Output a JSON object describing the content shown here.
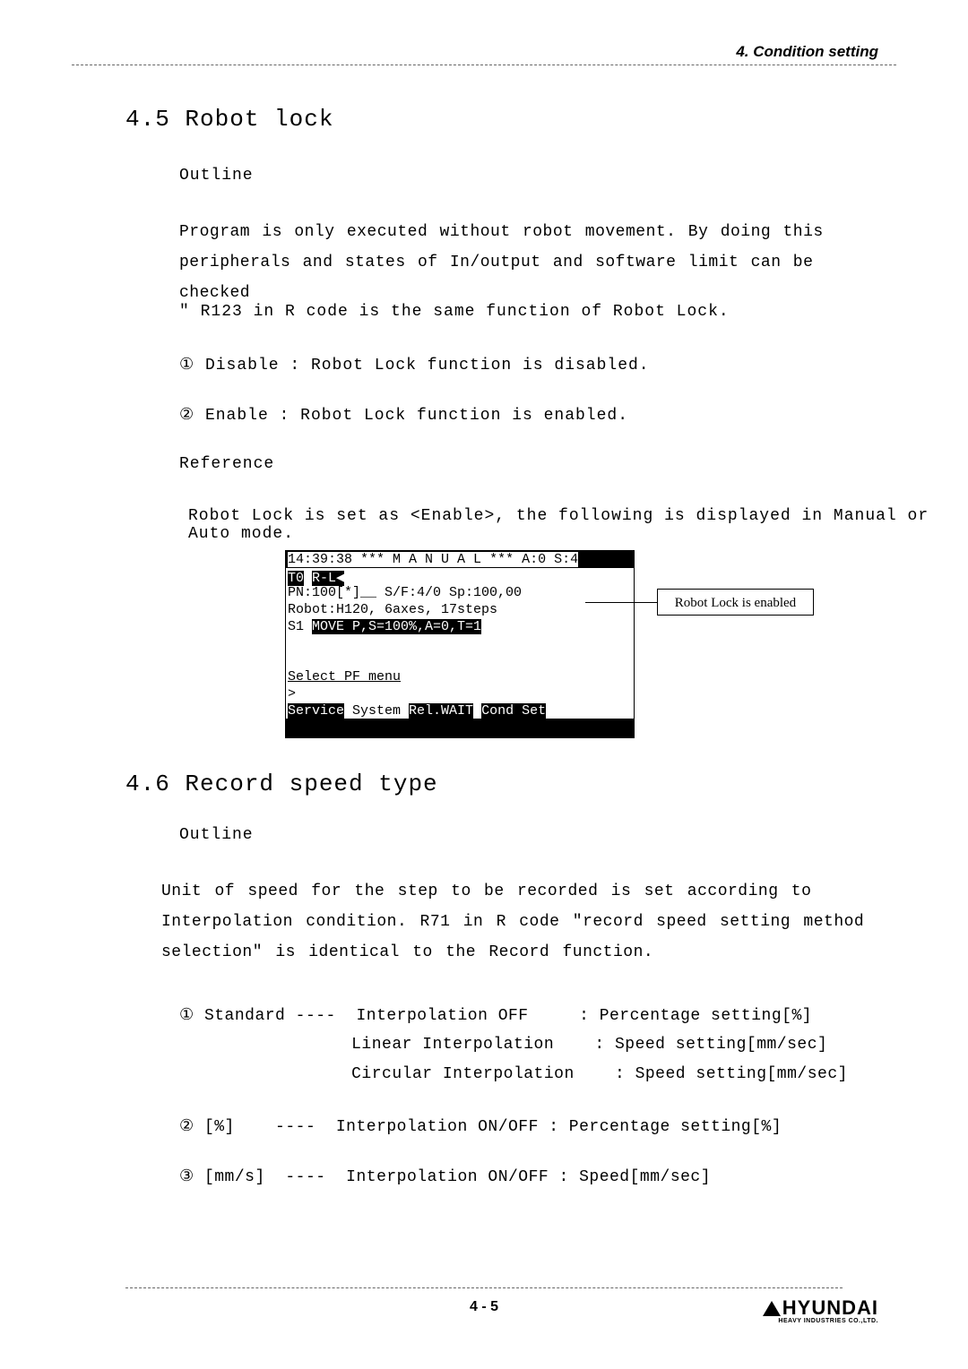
{
  "header": {
    "section_label": "4. Condition setting"
  },
  "section_45": {
    "heading": "4.5 Robot lock",
    "outline_label": "Outline",
    "body1": "Program is only executed without robot movement. By doing this peripherals and states of In/output and software limit can be checked",
    "r123": "\" R123 in R code is the same function of Robot Lock.",
    "disable": "① Disable : Robot Lock function is disabled.",
    "enable": "② Enable : Robot Lock function is enabled.",
    "reference_label": "Reference",
    "robotlock_set": "Robot Lock is set as <Enable>, the following is displayed in Manual or Auto mode.",
    "callout": "Robot Lock is enabled",
    "screen": {
      "line1_left": "14:39:38  *** ",
      "line1_mid": "M A N U A L",
      "line1_right": " ***    ",
      "line1_end": "A:0 S:4",
      "line2_left": "T0",
      "line2_mid": "             ",
      "line2_right": "R-L◀",
      "line3": "PN:100[*]__ S/F:4/0   Sp:100,00",
      "line4": "     Robot:H120, 6axes, 17steps",
      "line5_left": "S1   ",
      "line5_mid": "MOVE P,S=100%,A=0,T=1",
      "line8": "Select PF menu",
      "line9": ">",
      "line10_left": "Service",
      "line10_mid": "  System ",
      "line10_rel": "Rel.WAIT",
      "line10_right": "          ",
      "line10_end": "Cond Set"
    }
  },
  "section_46": {
    "heading": "4.6 Record speed type",
    "outline_label": "Outline",
    "body1": "Unit of speed for the step to be recorded is set according to Interpolation condition. R71 in R code \"record speed setting method selection\" is identical to the Record function.",
    "standard_l1": "① Standard ----  Interpolation OFF     : Percentage setting[%]",
    "standard_l2": "                 Linear Interpolation    : Speed setting[mm/sec]",
    "standard_l3": "                 Circular Interpolation    : Speed setting[mm/sec]",
    "pct": "② [%]    ----  Interpolation ON/OFF : Percentage setting[%]",
    "mms": "③ [mm/s]  ----  Interpolation ON/OFF : Speed[mm/sec]"
  },
  "footer": {
    "page_num": "4 - 5",
    "logo_text": "HYUNDAI",
    "logo_sub": "HEAVY INDUSTRIES CO.,LTD."
  }
}
